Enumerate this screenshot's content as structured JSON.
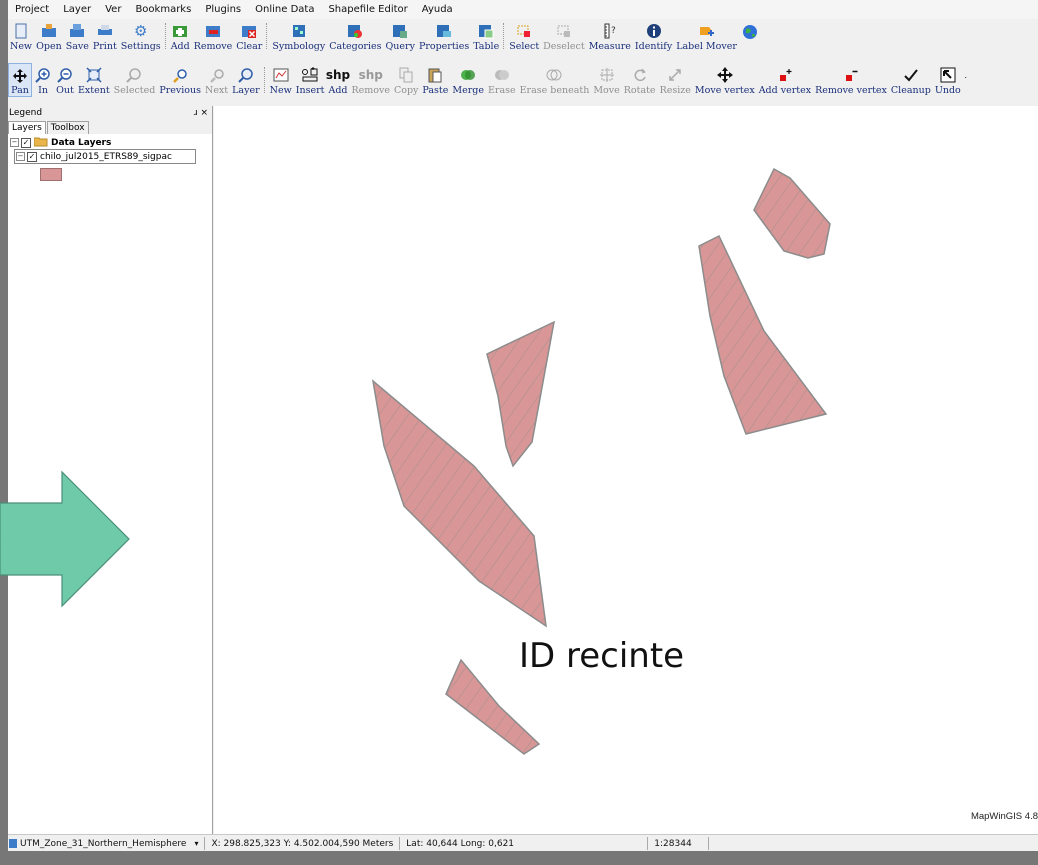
{
  "menubar": [
    "Project",
    "Layer",
    "Ver",
    "Bookmarks",
    "Plugins",
    "Online Data",
    "Shapefile Editor",
    "Ayuda"
  ],
  "toolbar1": {
    "file": [
      "New",
      "Open",
      "Save",
      "Print",
      "Settings"
    ],
    "layer": [
      "Add",
      "Remove",
      "Clear"
    ],
    "layer_props": [
      "Symbology",
      "Categories",
      "Query",
      "Properties",
      "Table"
    ],
    "selection": [
      "Select",
      "Deselect",
      "Measure",
      "Identify",
      "Label Mover"
    ]
  },
  "toolbar2": {
    "zoom": [
      "Pan",
      "In",
      "Out",
      "Extent",
      "Selected",
      "Previous",
      "Next",
      "Layer"
    ],
    "edit": [
      "New",
      "Insert",
      "Add",
      "Remove",
      "Copy",
      "Paste",
      "Merge",
      "Erase",
      "Erase beneath",
      "Move",
      "Rotate",
      "Resize",
      "Move vertex",
      "Add vertex",
      "Remove vertex",
      "Cleanup",
      "Undo"
    ],
    "shp_glyph": "shp"
  },
  "legend": {
    "title": "Legend",
    "pin": "ɹ ×",
    "tabs": [
      "Layers",
      "Toolbox"
    ],
    "group": "Data Layers",
    "layer": "chilo_jul2015_ETRS89_sigpac",
    "swatch_color": "#d89696"
  },
  "map": {
    "annotation": "ID recinte",
    "watermark": "MapWinGIS 4.8",
    "parcel_fill": "#d89696",
    "parcel_stroke": "#8c8c8c"
  },
  "arrow_color": "#6fcaaa",
  "statusbar": {
    "projection": "UTM_Zone_31_Northern_Hemisphere",
    "coords": "X: 298.825,323 Y: 4.502.004,590 Meters",
    "latlong": "Lat: 40,644 Long: 0,621",
    "scale": "1:28344"
  }
}
